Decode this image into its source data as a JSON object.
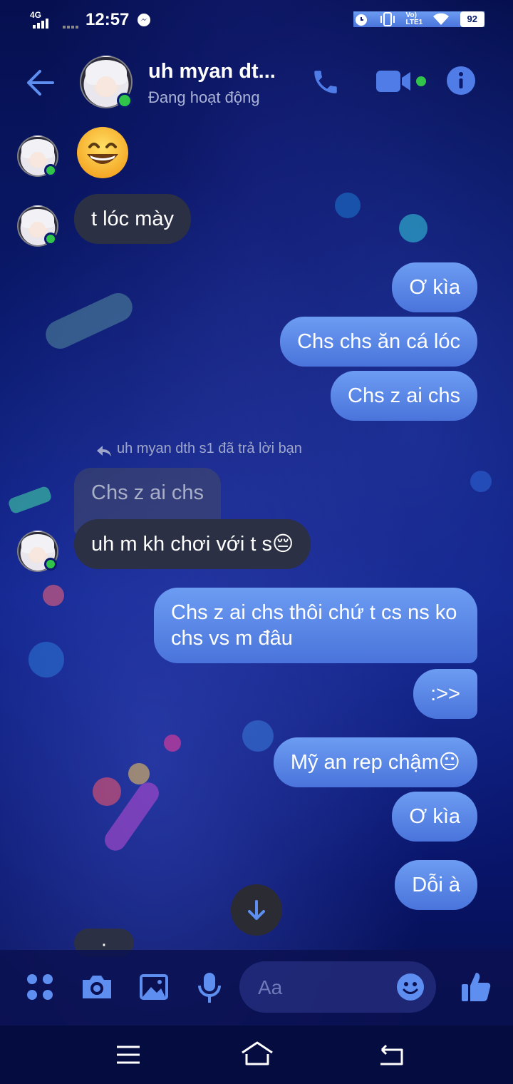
{
  "status_bar": {
    "network": "4G",
    "time": "12:57",
    "battery": "92",
    "volte": "Vo) LTE1"
  },
  "header": {
    "contact_name": "uh myan dt...",
    "presence": "Đang hoạt động"
  },
  "messages": {
    "m1": "t lóc mày",
    "m2": "Ơ kìa",
    "m3": "Chs chs ăn cá lóc",
    "m4": "Chs z ai chs",
    "reply_note": "uh myan dth s1 đã trả lời bạn",
    "quoted": "Chs z ai chs",
    "m5": "uh m kh chơi với t s😔",
    "m6": "Chs z ai chs thôi chứ t cs ns ko chs vs m đâu",
    "m7": ":>>",
    "m8": "Mỹ an rep chậm😐",
    "m9": "Ơ kìa",
    "m10": "Dỗi à",
    "m11_partial": "·"
  },
  "composer": {
    "placeholder": "Aa"
  },
  "icons": {
    "back": "back-arrow-icon",
    "call": "phone-icon",
    "video": "video-camera-icon",
    "info": "info-icon",
    "menu": "apps-grid-icon",
    "camera": "camera-icon",
    "gallery": "image-icon",
    "mic": "microphone-icon",
    "emoji": "emoji-icon",
    "like": "thumbs-up-icon",
    "scroll": "arrow-down-icon"
  },
  "colors": {
    "accent": "#4a74db",
    "online": "#31c44a",
    "incoming_bubble": "#2c3045"
  }
}
